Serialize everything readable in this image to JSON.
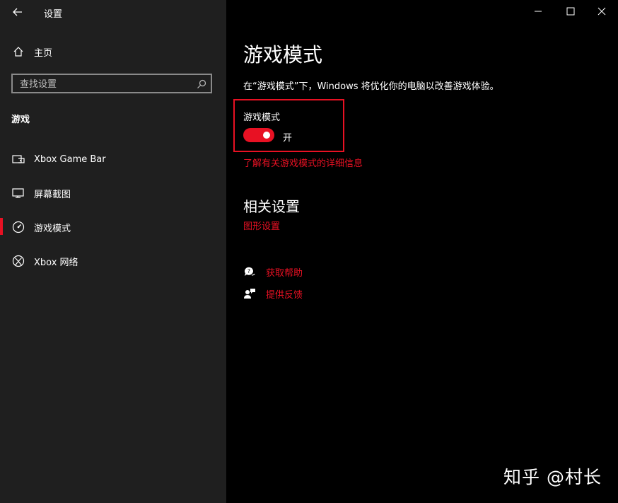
{
  "window": {
    "title": "设置"
  },
  "sidebar": {
    "home_label": "主页",
    "search_placeholder": "查找设置",
    "section_title": "游戏",
    "items": [
      {
        "label": "Xbox Game Bar",
        "icon": "gamebar-icon"
      },
      {
        "label": "屏幕截图",
        "icon": "capture-icon"
      },
      {
        "label": "游戏模式",
        "icon": "game-mode-icon",
        "active": true
      },
      {
        "label": "Xbox 网络",
        "icon": "xbox-icon"
      }
    ]
  },
  "main": {
    "title": "游戏模式",
    "description": "在“游戏模式”下，Windows 将优化你的电脑以改善游戏体验。",
    "toggle": {
      "label": "游戏模式",
      "state_text": "开",
      "on": true
    },
    "learn_more_link": "了解有关游戏模式的详细信息",
    "related_title": "相关设置",
    "related_link": "图形设置",
    "help_label": "获取帮助",
    "feedback_label": "提供反馈"
  },
  "watermark": "知乎 @村长",
  "colors": {
    "accent": "#e81123",
    "sidebar_bg": "#1f1f1f",
    "main_bg": "#000000"
  }
}
